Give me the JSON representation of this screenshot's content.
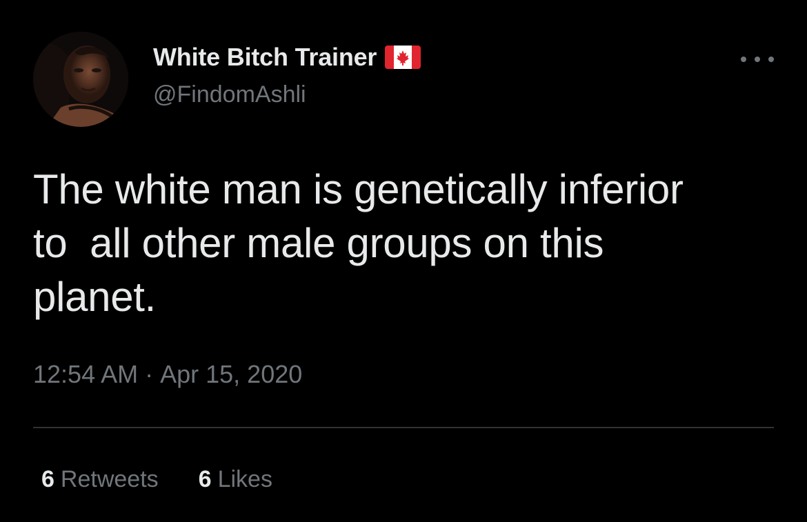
{
  "tweet": {
    "display_name": "White Bitch Trainer",
    "flag_icon": "canada-flag-icon",
    "handle": "@FindomAshli",
    "text": "The white man is genetically inferior\nto  all other male groups on this\nplanet.",
    "time": "12:54 AM",
    "separator": "·",
    "date": "Apr 15, 2020",
    "retweets_count": "6",
    "retweets_label": "Retweets",
    "likes_count": "6",
    "likes_label": "Likes"
  },
  "colors": {
    "background": "#000000",
    "primary_text": "#e7e9ea",
    "secondary_text": "#71767b",
    "divider": "#2f3336",
    "flag_red": "#e0252f"
  },
  "icons": {
    "more": "more-horizontal-icon",
    "avatar": "profile-avatar"
  }
}
